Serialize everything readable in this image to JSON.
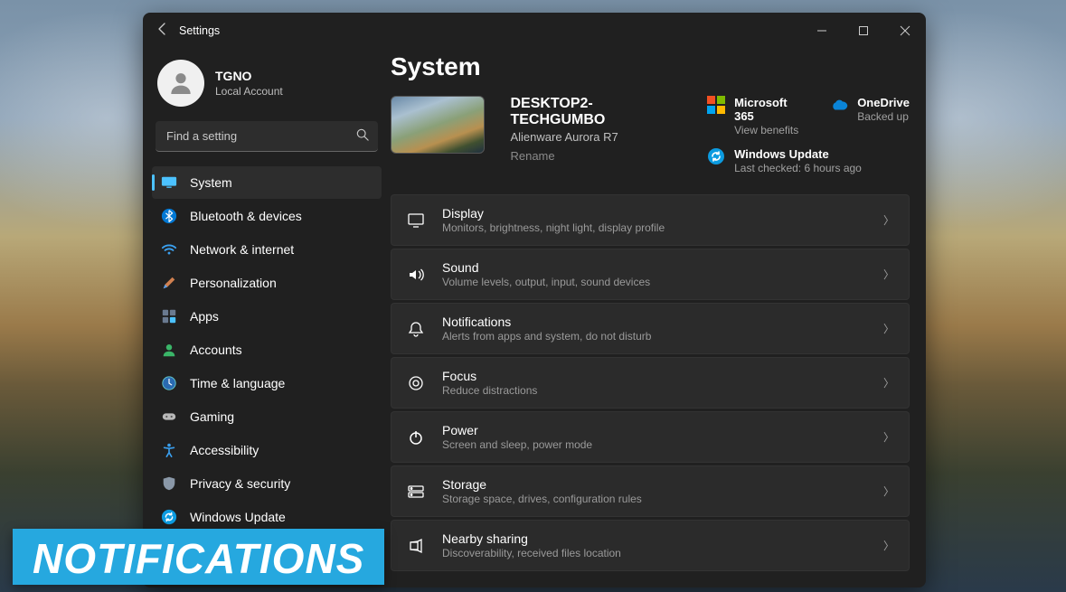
{
  "window": {
    "app_title": "Settings"
  },
  "profile": {
    "name": "TGNO",
    "account_type": "Local Account"
  },
  "search": {
    "placeholder": "Find a setting"
  },
  "sidebar": {
    "items": [
      {
        "label": "System"
      },
      {
        "label": "Bluetooth & devices"
      },
      {
        "label": "Network & internet"
      },
      {
        "label": "Personalization"
      },
      {
        "label": "Apps"
      },
      {
        "label": "Accounts"
      },
      {
        "label": "Time & language"
      },
      {
        "label": "Gaming"
      },
      {
        "label": "Accessibility"
      },
      {
        "label": "Privacy & security"
      },
      {
        "label": "Windows Update"
      }
    ]
  },
  "page": {
    "title": "System",
    "device": {
      "name": "DESKTOP2-TECHGUMBO",
      "model": "Alienware Aurora R7",
      "rename": "Rename"
    },
    "cards": {
      "ms365": {
        "title": "Microsoft 365",
        "sub": "View benefits"
      },
      "onedrive": {
        "title": "OneDrive",
        "sub": "Backed up"
      },
      "winupdate": {
        "title": "Windows Update",
        "sub": "Last checked: 6 hours ago"
      }
    },
    "settings": [
      {
        "title": "Display",
        "sub": "Monitors, brightness, night light, display profile"
      },
      {
        "title": "Sound",
        "sub": "Volume levels, output, input, sound devices"
      },
      {
        "title": "Notifications",
        "sub": "Alerts from apps and system, do not disturb"
      },
      {
        "title": "Focus",
        "sub": "Reduce distractions"
      },
      {
        "title": "Power",
        "sub": "Screen and sleep, power mode"
      },
      {
        "title": "Storage",
        "sub": "Storage space, drives, configuration rules"
      },
      {
        "title": "Nearby sharing",
        "sub": "Discoverability, received files location"
      }
    ]
  },
  "banner": {
    "text": "Notifications"
  }
}
